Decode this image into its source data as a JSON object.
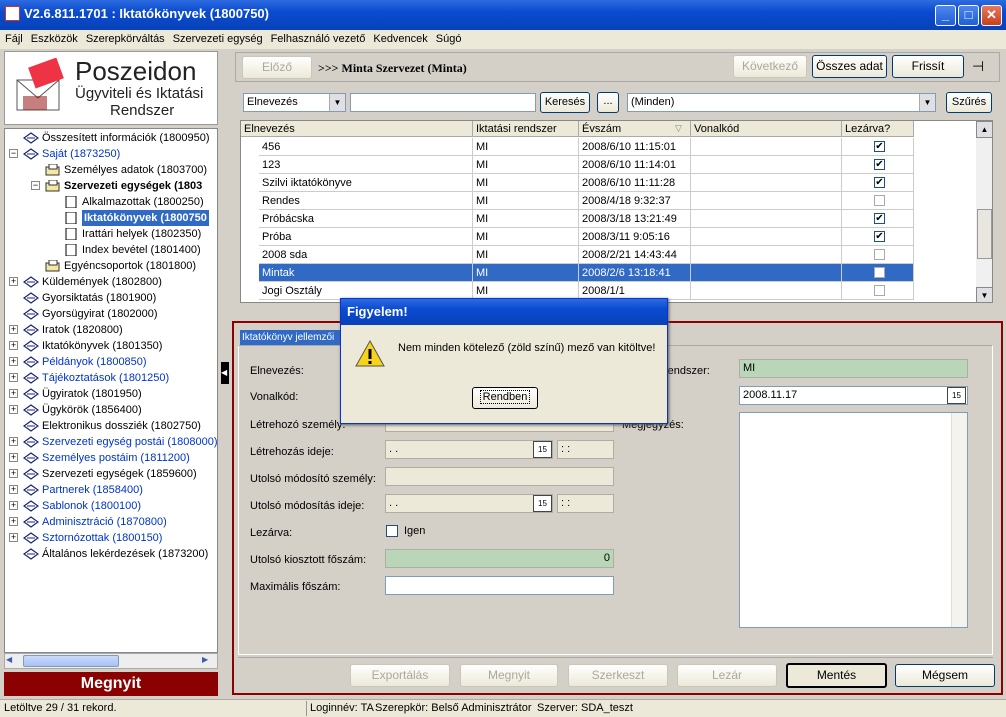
{
  "window": {
    "title": "V2.6.811.1701 : Iktatókönyvek (1800750)"
  },
  "menu": [
    "Fájl",
    "Eszközök",
    "Szerepkörváltás",
    "Szervezeti egység",
    "Felhasználó vezető",
    "Kedvencek",
    "Súgó"
  ],
  "logo": {
    "line1": "Poszeidon",
    "line2": "Ügyviteli és Iktatási",
    "line3": "Rendszer"
  },
  "tree": [
    {
      "label": "Összesített információk (1800950)",
      "color": "black"
    },
    {
      "label": "Saját (1873250)",
      "color": "blue"
    },
    {
      "label": "Személyes adatok (1803700)",
      "color": "black"
    },
    {
      "label": "Szervezeti egységek (1803",
      "color": "black"
    },
    {
      "label": "Alkalmazottak (1800250)",
      "color": "black"
    },
    {
      "label": "Iktatókönyvek (1800750",
      "color": "black"
    },
    {
      "label": "Irattári helyek (1802350)",
      "color": "black"
    },
    {
      "label": "Index bevétel (1801400)",
      "color": "black"
    },
    {
      "label": "Egyéncsoportok (1801800)",
      "color": "black"
    },
    {
      "label": "Küldemények (1802800)",
      "color": "black"
    },
    {
      "label": "Gyorsiktatás (1801900)",
      "color": "black"
    },
    {
      "label": "Gyorsügyirat (1802000)",
      "color": "black"
    },
    {
      "label": "Iratok (1820800)",
      "color": "black"
    },
    {
      "label": "Iktatókönyvek (1801350)",
      "color": "black"
    },
    {
      "label": "Példányok (1800850)",
      "color": "blue"
    },
    {
      "label": "Tájékoztatások (1801250)",
      "color": "blue"
    },
    {
      "label": "Ügyiratok (1801950)",
      "color": "black"
    },
    {
      "label": "Ügykörök (1856400)",
      "color": "black"
    },
    {
      "label": "Elektronikus dossziék (1802750)",
      "color": "black"
    },
    {
      "label": "Szervezeti egység postái (1808000)",
      "color": "blue"
    },
    {
      "label": "Személyes postáim (1811200)",
      "color": "blue"
    },
    {
      "label": "Szervezeti egységek (1859600)",
      "color": "black"
    },
    {
      "label": "Partnerek (1858400)",
      "color": "blue"
    },
    {
      "label": "Sablonok (1800100)",
      "color": "blue"
    },
    {
      "label": "Adminisztráció (1870800)",
      "color": "blue"
    },
    {
      "label": "Sztornózottak (1800150)",
      "color": "blue"
    },
    {
      "label": "Általános lekérdezések (1873200)",
      "color": "black"
    }
  ],
  "left_open_button": "Megnyit",
  "toolbar": {
    "prev": "Előző",
    "breadcrumb": ">>> Minta Szervezet (Minta)",
    "next": "Következő",
    "all_data": "Összes adat",
    "refresh": "Frissít"
  },
  "search": {
    "field": "Elnevezés",
    "value": "",
    "search_btn": "Keresés",
    "dots_btn": "...",
    "filter_value": "(Minden)",
    "filter_btn": "Szűrés"
  },
  "grid": {
    "columns": [
      "Elnevezés",
      "Iktatási rendszer",
      "Évszám",
      "Vonalkód",
      "Lezárva?"
    ],
    "rows": [
      {
        "name": "456",
        "sys": "MI",
        "year": "2008/6/10 11:15:01",
        "barcode": "",
        "closed": true
      },
      {
        "name": "123",
        "sys": "MI",
        "year": "2008/6/10 11:14:01",
        "barcode": "",
        "closed": true
      },
      {
        "name": "Szilvi iktatókönyve",
        "sys": "MI",
        "year": "2008/6/10 11:11:28",
        "barcode": "",
        "closed": true
      },
      {
        "name": "Rendes",
        "sys": "MI",
        "year": "2008/4/18 9:32:37",
        "barcode": "",
        "closed": false
      },
      {
        "name": "Próbácska",
        "sys": "MI",
        "year": "2008/3/18 13:21:49",
        "barcode": "",
        "closed": true
      },
      {
        "name": "Próba",
        "sys": "MI",
        "year": "2008/3/11 9:05:16",
        "barcode": "",
        "closed": true
      },
      {
        "name": "2008 sda",
        "sys": "MI",
        "year": "2008/2/21 14:43:44",
        "barcode": "",
        "closed": false
      },
      {
        "name": "Mintak",
        "sys": "MI",
        "year": "2008/2/6 13:18:41",
        "barcode": "",
        "closed": false
      },
      {
        "name": "Jogi Osztály",
        "sys": "MI",
        "year": "2008/1/1",
        "barcode": "",
        "closed": false
      }
    ]
  },
  "detail": {
    "tab": "Iktatókönyv jellemzői",
    "labels": {
      "name": "Elnevezés:",
      "barcode": "Vonalkód:",
      "creator": "Létrehozó személy:",
      "created": "Létrehozás ideje:",
      "modifier": "Utolsó módosító személy:",
      "modified": "Utolsó módosítás ideje:",
      "closed": "Lezárva:",
      "last_main": "Utolsó kiosztott főszám:",
      "max_main": "Maximális főszám:",
      "system": "rendszer:",
      "note": "Megjegyzés:"
    },
    "date_placeholder": " .  .",
    "time_placeholder": " :  :",
    "closed_option": "Igen",
    "last_main_value": "0",
    "system_value": "MI",
    "date_value": "2008.11.17",
    "cal_icon": "15"
  },
  "buttons": {
    "export": "Exportálás",
    "open": "Megnyit",
    "edit": "Szerkeszt",
    "lock": "Lezár",
    "save": "Mentés",
    "cancel": "Mégsem"
  },
  "dialog": {
    "title": "Figyelem!",
    "message": "Nem minden kötelező (zöld színű) mező van kitöltve!",
    "ok": "Rendben"
  },
  "status": {
    "records": "Letöltve 29 / 31 rekord.",
    "login": "Loginnév: TA",
    "role": "Szerepkör: Belső Adminisztrátor",
    "server": "Szerver: SDA_teszt"
  }
}
